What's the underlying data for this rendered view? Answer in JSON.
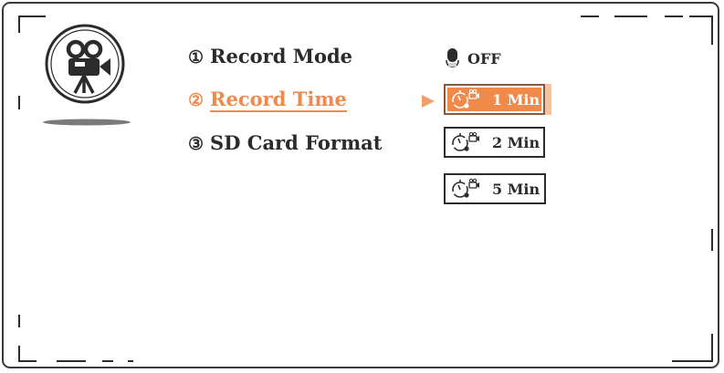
{
  "menu": {
    "items": [
      {
        "number": "①",
        "label": "Record Mode"
      },
      {
        "number": "②",
        "label": "Record Time"
      },
      {
        "number": "③",
        "label": "SD Card Format"
      }
    ],
    "active_index": 1
  },
  "record_mode": {
    "value": "OFF",
    "icon": "microphone-off-icon"
  },
  "record_time": {
    "options": [
      {
        "label": "1 Min",
        "icon": "timer-video-icon"
      },
      {
        "label": "2 Min",
        "icon": "timer-video-icon"
      },
      {
        "label": "5 Min",
        "icon": "timer-video-icon"
      }
    ],
    "selected_index": 0
  },
  "colors": {
    "accent": "#f08a4b",
    "text": "#2b2b2b",
    "frame": "#3a3a3a"
  }
}
